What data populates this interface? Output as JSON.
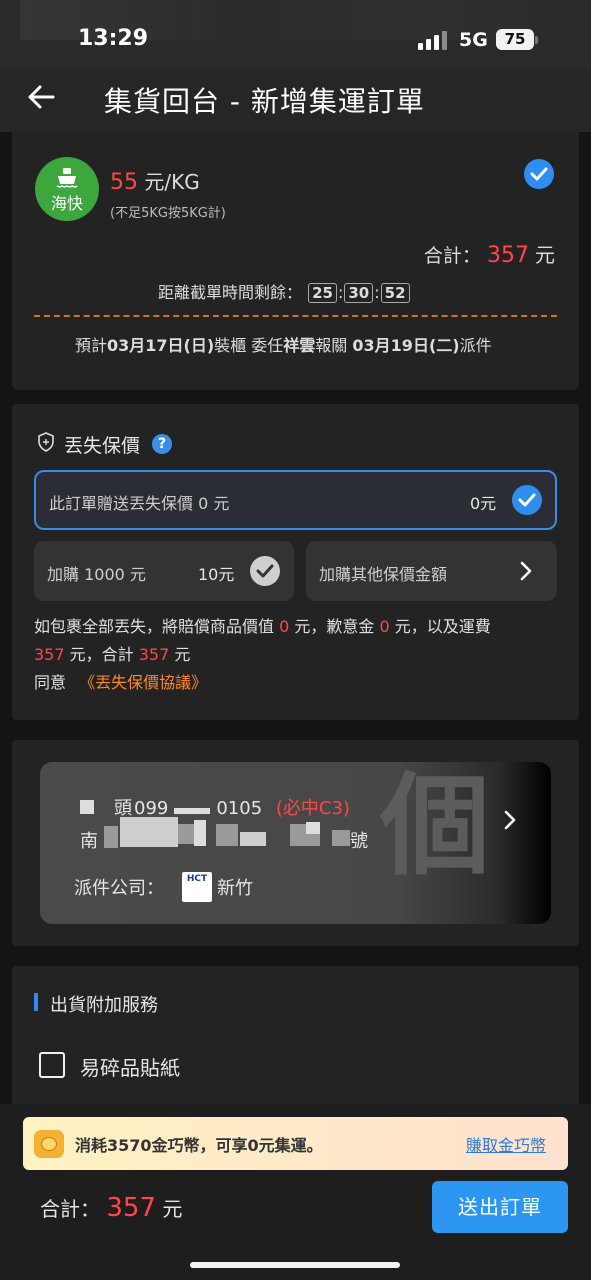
{
  "status": {
    "time": "13:29",
    "network": "5G",
    "battery": "75"
  },
  "header": {
    "title": "集貨回台 - 新增集運訂單"
  },
  "shipping": {
    "badge_label": "海快",
    "rate_value": "55",
    "rate_unit": "元/KG",
    "rate_note": "(不足5KG按5KG計)",
    "total_label": "合計：",
    "total_value": "357",
    "total_unit": "元",
    "countdown_label": "距離截單時間剩餘：",
    "countdown_h": "25",
    "countdown_m": "30",
    "countdown_s": "52",
    "eta_prefix": "預計",
    "eta_pack_date": "03月17日(日)",
    "eta_pack_text": "裝櫃 委任",
    "eta_agent": "祥雲",
    "eta_customs": "報關",
    "eta_deliver_date": "03月19日(二)",
    "eta_deliver_text": "派件"
  },
  "insurance": {
    "title": "丟失保價",
    "help": "?",
    "selected_label": "此訂單贈送丟失保價 0 元",
    "selected_value": "0元",
    "option1_label": "加購 1000 元",
    "option1_value": "10元",
    "option2_label": "加購其他保價金額",
    "note_p1": "如包裹全部丟失，將賠償商品價值 ",
    "note_v1": "0",
    "note_p2": " 元，歉意金 ",
    "note_v2": "0",
    "note_p3": " 元，以及運費",
    "note_v3": "357",
    "note_p4": " 元，合計 ",
    "note_v4": "357",
    "note_p5": " 元",
    "agree_label": "同意",
    "agreement_link": "《丟失保價協議》"
  },
  "address": {
    "line1_a": "頭",
    "line1_b": "099",
    "line1_c": "0105",
    "pickup_tag": "(必中C3)",
    "line2_a": "南",
    "line2_b": "號",
    "courier_label": "派件公司：",
    "courier_name": "新竹",
    "courier_logo_text": "HCT"
  },
  "extras": {
    "title": "出貨附加服務",
    "fragile_label": "易碎品貼紙"
  },
  "footer": {
    "promo_text": "消耗3570金巧幣，可享0元集運。",
    "promo_link": "賺取金巧幣",
    "total_label": "合計：",
    "total_value": "357",
    "total_unit": "元",
    "submit_label": "送出訂單"
  },
  "colors": {
    "accent_blue": "#2d8ef0",
    "price_red": "#ff4747",
    "link_orange": "#ff8a1f",
    "ship_green": "#3da63d"
  }
}
